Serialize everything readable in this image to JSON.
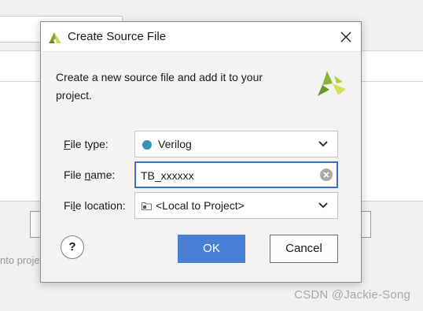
{
  "background": {
    "partial_text": "nto proje",
    "watermark": "CSDN @Jackie-Song"
  },
  "dialog": {
    "title": "Create Source File",
    "description": "Create a new source file and add it to your project.",
    "file_type": {
      "label_prefix": "",
      "label_mnemonic": "F",
      "label_rest": "ile type:",
      "value": "Verilog",
      "dot_color": "#3f8fb0"
    },
    "file_name": {
      "label_prefix": "File ",
      "label_mnemonic": "n",
      "label_rest": "ame:",
      "value": "TB_xxxxxx"
    },
    "file_location": {
      "label_prefix": "Fi",
      "label_mnemonic": "l",
      "label_rest": "e location:",
      "value": "<Local to Project>"
    },
    "help_label": "?",
    "ok_label": "OK",
    "cancel_label": "Cancel"
  },
  "colors": {
    "accent": "#4a7fd6",
    "focus_border": "#3f6fbf",
    "logo_green": "#8cb43c",
    "logo_yellow": "#d4e157"
  }
}
